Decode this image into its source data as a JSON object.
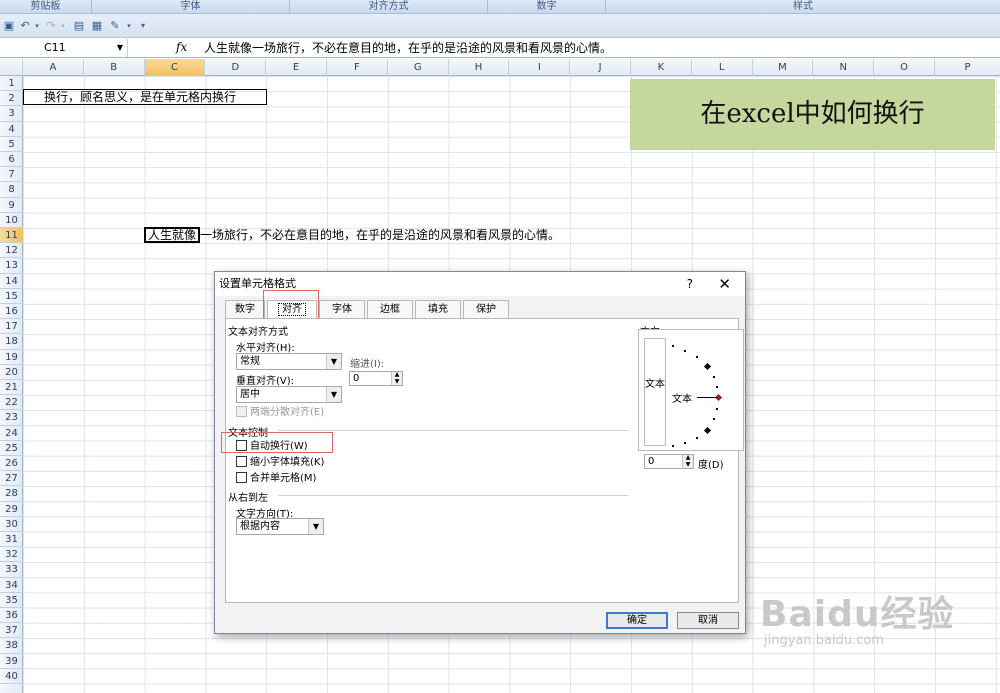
{
  "ribbon": {
    "groups": [
      "剪贴板",
      "字体",
      "对齐方式",
      "数字",
      "样式"
    ]
  },
  "formula_bar": {
    "name_box": "C11",
    "fx": "fx",
    "content": "人生就像一场旅行，不必在意目的地，在乎的是沿途的风景和看风景的心情。"
  },
  "grid": {
    "columns": [
      "A",
      "B",
      "C",
      "D",
      "E",
      "F",
      "G",
      "H",
      "I",
      "J",
      "K",
      "L",
      "M",
      "N",
      "O",
      "P"
    ],
    "rows": [
      "1",
      "2",
      "3",
      "4",
      "5",
      "6",
      "7",
      "8",
      "9",
      "10",
      "11",
      "12",
      "13",
      "14",
      "15",
      "16",
      "17",
      "18",
      "19",
      "20",
      "21",
      "22",
      "23",
      "24",
      "25",
      "26",
      "27",
      "28",
      "29",
      "30",
      "31",
      "32",
      "33",
      "34",
      "35",
      "36",
      "37",
      "38",
      "39",
      "40"
    ],
    "selected_column": "C",
    "selected_row": "11",
    "cell_a2": "换行，顾名思义，是在单元格内换行",
    "cell_c11_active": "人生就像",
    "cell_c11_rest": "一场旅行，不必在意目的地，在乎的是沿途的风景和看风景的心情。"
  },
  "banner": {
    "text": "在excel中如何换行",
    "color": "#c5d79d"
  },
  "dialog": {
    "title": "设置单元格格式",
    "help": "?",
    "close": "✕",
    "tabs": [
      "数字",
      "对齐",
      "字体",
      "边框",
      "填充",
      "保护"
    ],
    "active_tab": "对齐",
    "text_alignment": {
      "section": "文本对齐方式",
      "horizontal_label": "水平对齐(H):",
      "horizontal_value": "常规",
      "indent_label": "缩进(I):",
      "indent_value": "0",
      "vertical_label": "垂直对齐(V):",
      "vertical_value": "居中",
      "justify_distributed": "两端分散对齐(E)"
    },
    "text_control": {
      "section": "文本控制",
      "wrap_text": "自动换行(W)",
      "shrink_to_fit": "缩小字体填充(K)",
      "merge_cells": "合并单元格(M)"
    },
    "right_to_left": {
      "section": "从右到左",
      "direction_label": "文字方向(T):",
      "direction_value": "根据内容"
    },
    "orientation": {
      "section": "方向",
      "vertical_text": "文本",
      "text": "文本",
      "degrees_value": "0",
      "degrees_label": "度(D)"
    },
    "ok": "确定",
    "cancel": "取消"
  },
  "watermark": {
    "brand": "Baidu经验",
    "url": "jingyan.baidu.com"
  }
}
